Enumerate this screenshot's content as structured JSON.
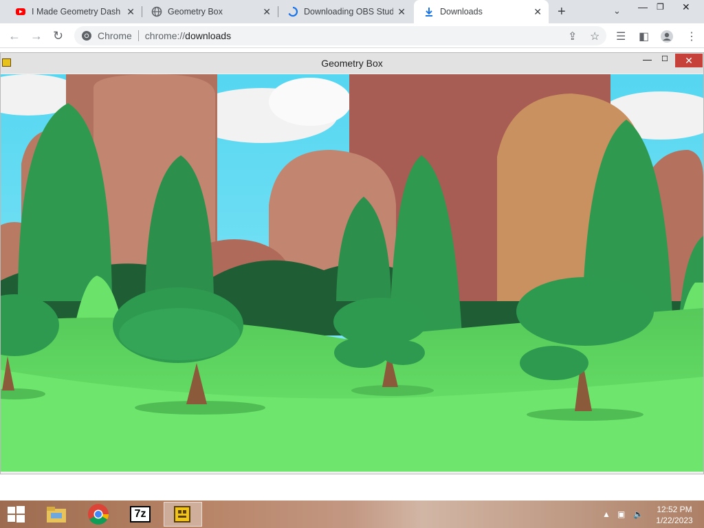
{
  "browser": {
    "tabs": [
      {
        "title": "I Made Geometry Dash a",
        "icon": "youtube-icon",
        "active": false
      },
      {
        "title": "Geometry Box",
        "icon": "globe-icon",
        "active": false
      },
      {
        "title": "Downloading OBS Studio",
        "icon": "loading-spinner-icon",
        "active": false
      },
      {
        "title": "Downloads",
        "icon": "download-icon",
        "active": true
      }
    ],
    "omnibox": {
      "chip": "Chrome",
      "url_scheme": "chrome://",
      "url_path": "downloads"
    }
  },
  "game_window": {
    "title": "Geometry Box"
  },
  "taskbar": {
    "time": "12:52 PM",
    "date": "1/22/2023",
    "apps": [
      "start-button",
      "file-explorer",
      "chrome",
      "7-zip",
      "geometry-box"
    ],
    "sevenzip_label": "7z"
  },
  "colors": {
    "sky": "#5ddcf5",
    "grass": "#6be36b",
    "taskbar": "#a97a5e"
  }
}
